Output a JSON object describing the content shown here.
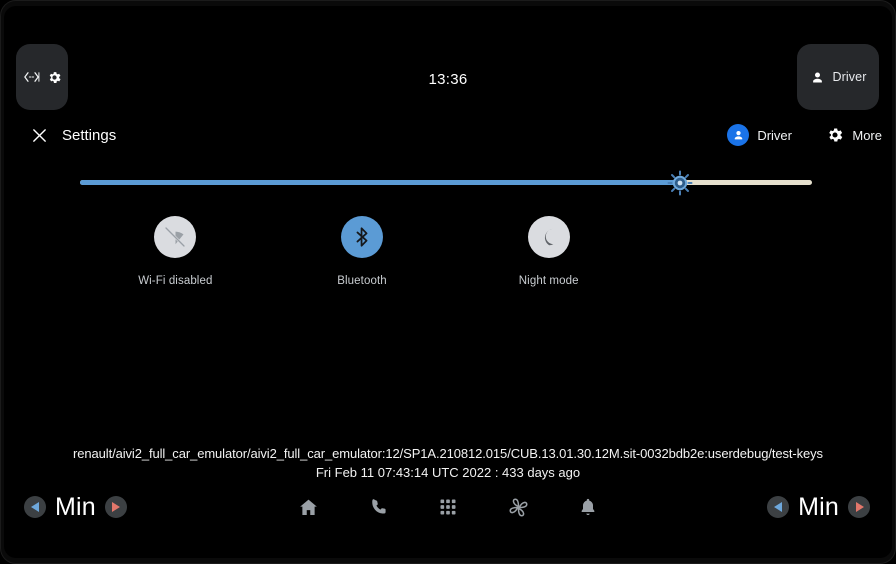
{
  "device": {
    "frame_color": "#0a0a0a",
    "screen_background": "#000000"
  },
  "status_bar": {
    "clock": "13:36",
    "left_chip": {
      "icons": [
        "code-arrows-icon",
        "gear-icon"
      ]
    },
    "right_chip": {
      "icon": "person-icon",
      "label": "Driver"
    }
  },
  "quick_settings": {
    "close_icon": "close-icon",
    "title": "Settings",
    "user_button": {
      "icon": "account-circle-icon",
      "label": "Driver"
    },
    "more_button": {
      "icon": "gear-icon",
      "label": "More"
    },
    "brightness": {
      "icon": "brightness-icon",
      "value_percent": 82,
      "fill_color": "#5b9bd5",
      "track_color": "#e6e0ce"
    },
    "tiles": [
      {
        "label": "Wi-Fi disabled",
        "icon": "wifi-off-icon",
        "state": "off",
        "circle_color": "#dadce0",
        "glyph_color": "#9aa0a6"
      },
      {
        "label": "Bluetooth",
        "icon": "bluetooth-icon",
        "state": "on",
        "circle_color": "#5b9bd5",
        "glyph_color": "#16181b"
      },
      {
        "label": "Night mode",
        "icon": "moon-icon",
        "state": "off",
        "circle_color": "#dadce0",
        "glyph_color": "#5f6368"
      }
    ]
  },
  "build_info": {
    "fingerprint": "renault/aivi2_full_car_emulator/aivi2_full_car_emulator:12/SP1A.210812.015/CUB.13.01.30.12M.sit-0032bdb2e:userdebug/test-keys",
    "date_line": "Fri Feb 11 07:43:14 UTC 2022 : 433 days ago"
  },
  "nav_bar": {
    "temp_left": {
      "decrease_icon": "triangle-left-icon",
      "value": "Min",
      "increase_icon": "triangle-right-icon"
    },
    "temp_right": {
      "decrease_icon": "triangle-left-icon",
      "value": "Min",
      "increase_icon": "triangle-right-icon"
    },
    "icons": [
      {
        "name": "home-icon"
      },
      {
        "name": "phone-icon"
      },
      {
        "name": "app-grid-icon"
      },
      {
        "name": "fan-icon"
      },
      {
        "name": "bell-icon"
      }
    ],
    "icon_color": "#9aa0a6"
  }
}
